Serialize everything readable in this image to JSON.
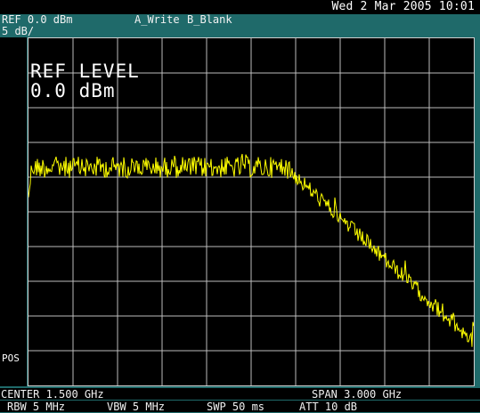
{
  "status": {
    "datetime": "Wed  2 Mar 2005 10:01"
  },
  "header": {
    "ref": "REF 0.0 dBm",
    "scale": "5 dB/",
    "trace_a": "A_Write",
    "trace_b": "B_Blank"
  },
  "screen": {
    "ref_level_title": "REF LEVEL",
    "ref_level_value": "0.0 dBm",
    "trace_color": "#ffff00",
    "grid_color": "#bdbdbd",
    "grid": true
  },
  "side": {
    "pos_label": "POS"
  },
  "footer": {
    "center": "CENTER 1.500 GHz",
    "span": "SPAN 3.000 GHz",
    "rbw": "RBW 5 MHz",
    "vbw": "VBW 5 MHz",
    "swp": "SWP 50 ms",
    "att": "ATT 10 dB"
  }
}
